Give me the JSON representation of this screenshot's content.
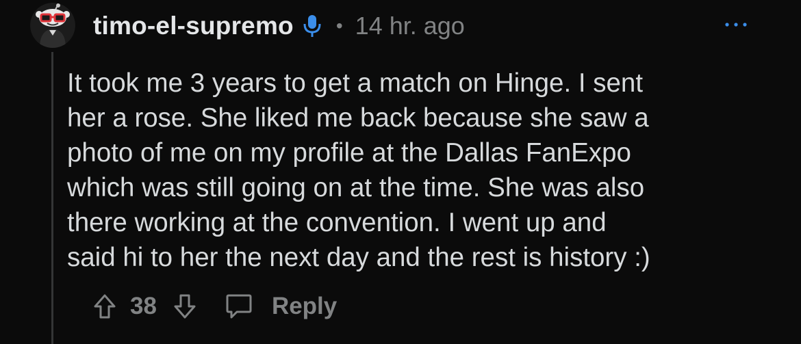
{
  "comment": {
    "author": "timo-el-supremo",
    "separator": "•",
    "timestamp": "14 hr. ago",
    "body_lines": [
      "It took me 3 years to get a match on Hinge. I sent",
      "her a rose. She liked me back because she saw a",
      "photo of me on my profile at the Dallas FanExpo",
      "which was still going on at the time. She was also",
      "there working at the convention. I went up and",
      "said hi to her the next day and the rest is history :)"
    ],
    "vote_count": "38",
    "reply_label": "Reply"
  },
  "colors": {
    "background": "#0b0b0b",
    "text_primary": "#d7dadc",
    "text_muted": "#818384",
    "accent_blue": "#3b8eea",
    "thread_line": "#343536"
  },
  "icons": {
    "avatar": "snoo-avatar",
    "voice": "microphone-icon",
    "more": "more-options-icon",
    "upvote": "arrow-up-icon",
    "downvote": "arrow-down-icon",
    "reply": "comment-bubble-icon"
  }
}
